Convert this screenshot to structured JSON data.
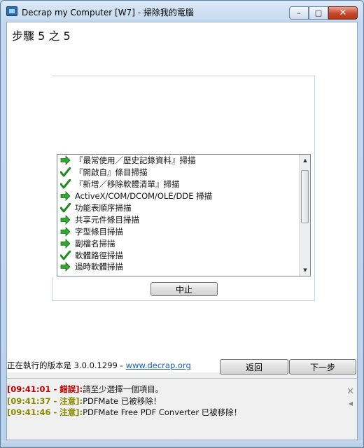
{
  "window": {
    "title": "Decrap my Computer [W7] - 掃除我的電腦",
    "minimize_label": "–",
    "maximize_label": "□",
    "close_label": "✕"
  },
  "wizard": {
    "step_label": "步驟 5 之 5"
  },
  "tasks": [
    {
      "label": "『最常使用／歷史記錄資料』掃描",
      "status": "arrow"
    },
    {
      "label": "『開啟自』條目掃描",
      "status": "check"
    },
    {
      "label": "『新增／移除軟體清單』掃描",
      "status": "check"
    },
    {
      "label": "ActiveX/COM/DCOM/OLE/DDE 掃描",
      "status": "arrow"
    },
    {
      "label": "功能表順序掃描",
      "status": "check"
    },
    {
      "label": "共享元件條目掃描",
      "status": "arrow"
    },
    {
      "label": "字型條目掃描",
      "status": "arrow"
    },
    {
      "label": "副檔名掃描",
      "status": "arrow"
    },
    {
      "label": "軟體路徑掃描",
      "status": "check"
    },
    {
      "label": "過時軟體掃描",
      "status": "arrow"
    }
  ],
  "stop_button": "中止",
  "footer": {
    "version_text": "正在執行的版本是 3.0.0.1299 -",
    "version_link": "www.decrap.org",
    "back_button": "返回",
    "next_button": "下一步"
  },
  "log": [
    {
      "timestamp": "[09:41:01 - 錯誤]:",
      "message": "請至少選擇一個項目。",
      "color": "#c00000"
    },
    {
      "timestamp": "[09:41:37 - 注意]:",
      "message": "PDFMate 已被移除！",
      "color": "#8a8a00"
    },
    {
      "timestamp": "[09:41:46 - 注意]:",
      "message": "PDFMate Free PDF Converter 已被移除！",
      "color": "#8a8a00"
    }
  ],
  "colors": {
    "arrow_green": "#2fa82f",
    "check_green": "#1f8a1f",
    "link_blue": "#1a5fb4"
  },
  "icons": {
    "arrow": "green-right-arrow-icon",
    "check": "green-checkmark-icon"
  }
}
